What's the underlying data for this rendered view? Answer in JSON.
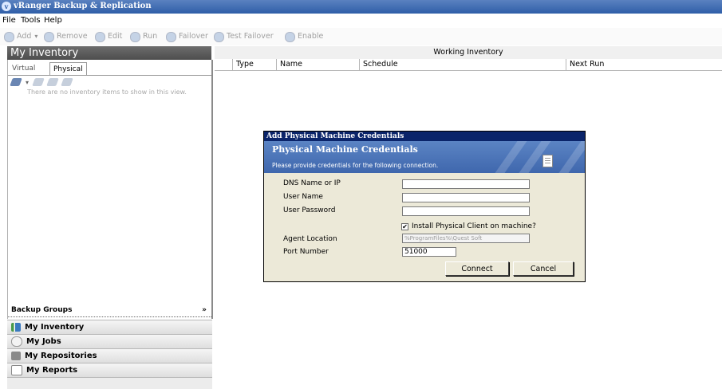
{
  "window": {
    "title": "vRanger Backup & Replication"
  },
  "menu": [
    "File",
    "Tools",
    "Help"
  ],
  "toolbar": {
    "add": "Add",
    "remove": "Remove",
    "edit": "Edit",
    "run": "Run",
    "failover": "Failover",
    "test_failover": "Test Failover",
    "enable": "Enable"
  },
  "left": {
    "title": "My Inventory",
    "tabs": [
      "Virtual",
      "Physical"
    ],
    "active_tab": "Physical",
    "empty_message": "There are no inventory items to show in this view.",
    "backup_groups": "Backup Groups",
    "nav": [
      {
        "label": "My Inventory",
        "icon": "inventory-icon"
      },
      {
        "label": "My Jobs",
        "icon": "jobs-icon"
      },
      {
        "label": "My Repositories",
        "icon": "repository-icon"
      },
      {
        "label": "My Reports",
        "icon": "report-icon"
      }
    ]
  },
  "main": {
    "title": "Working Inventory",
    "columns": [
      "Type",
      "Name",
      "Schedule",
      "Next Run"
    ]
  },
  "dialog": {
    "title": "Add Physical Machine Credentials",
    "heading": "Physical Machine Credentials",
    "subtitle": "Please provide credentials for the following connection.",
    "labels": {
      "dns": "DNS Name or IP",
      "user": "User Name",
      "password": "User Password",
      "install_client": "Install Physical Client on machine?",
      "agent_location": "Agent Location",
      "port": "Port Number"
    },
    "values": {
      "dns": "",
      "user": "",
      "password": "",
      "install_client_checked": true,
      "agent_location": "%ProgramFiles%\\Quest Soft",
      "port": "51000"
    },
    "buttons": {
      "connect": "Connect",
      "cancel": "Cancel"
    }
  }
}
